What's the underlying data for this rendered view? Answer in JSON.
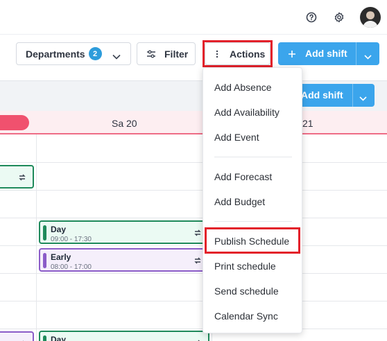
{
  "topbar": {
    "icons": [
      "help-icon",
      "settings-icon",
      "avatar"
    ]
  },
  "toolbar": {
    "departments_label": "Departments",
    "departments_count": "2",
    "filter_label": "Filter",
    "actions_label": "Actions",
    "add_shift_label": "Add shift"
  },
  "calendar": {
    "add_shift_label": "Add shift",
    "days": [
      "Sa 20",
      "21"
    ]
  },
  "shifts": [
    {
      "name": "Day",
      "time": "09:00 - 17:30",
      "color": "#1f8a5b"
    },
    {
      "name": "Early",
      "time": "08:00 - 17:00",
      "color": "#8b5cc8"
    },
    {
      "name": "Day",
      "time": "",
      "color": "#1f8a5b"
    }
  ],
  "menu": {
    "group1": [
      "Add Absence",
      "Add Availability",
      "Add Event"
    ],
    "group2": [
      "Add Forecast",
      "Add Budget"
    ],
    "group3": [
      "Publish Schedule",
      "Print schedule",
      "Send schedule",
      "Calendar Sync"
    ]
  },
  "colors": {
    "accent": "#3ba5ec",
    "highlight": "#e3202a",
    "weekend": "#f0516e"
  }
}
